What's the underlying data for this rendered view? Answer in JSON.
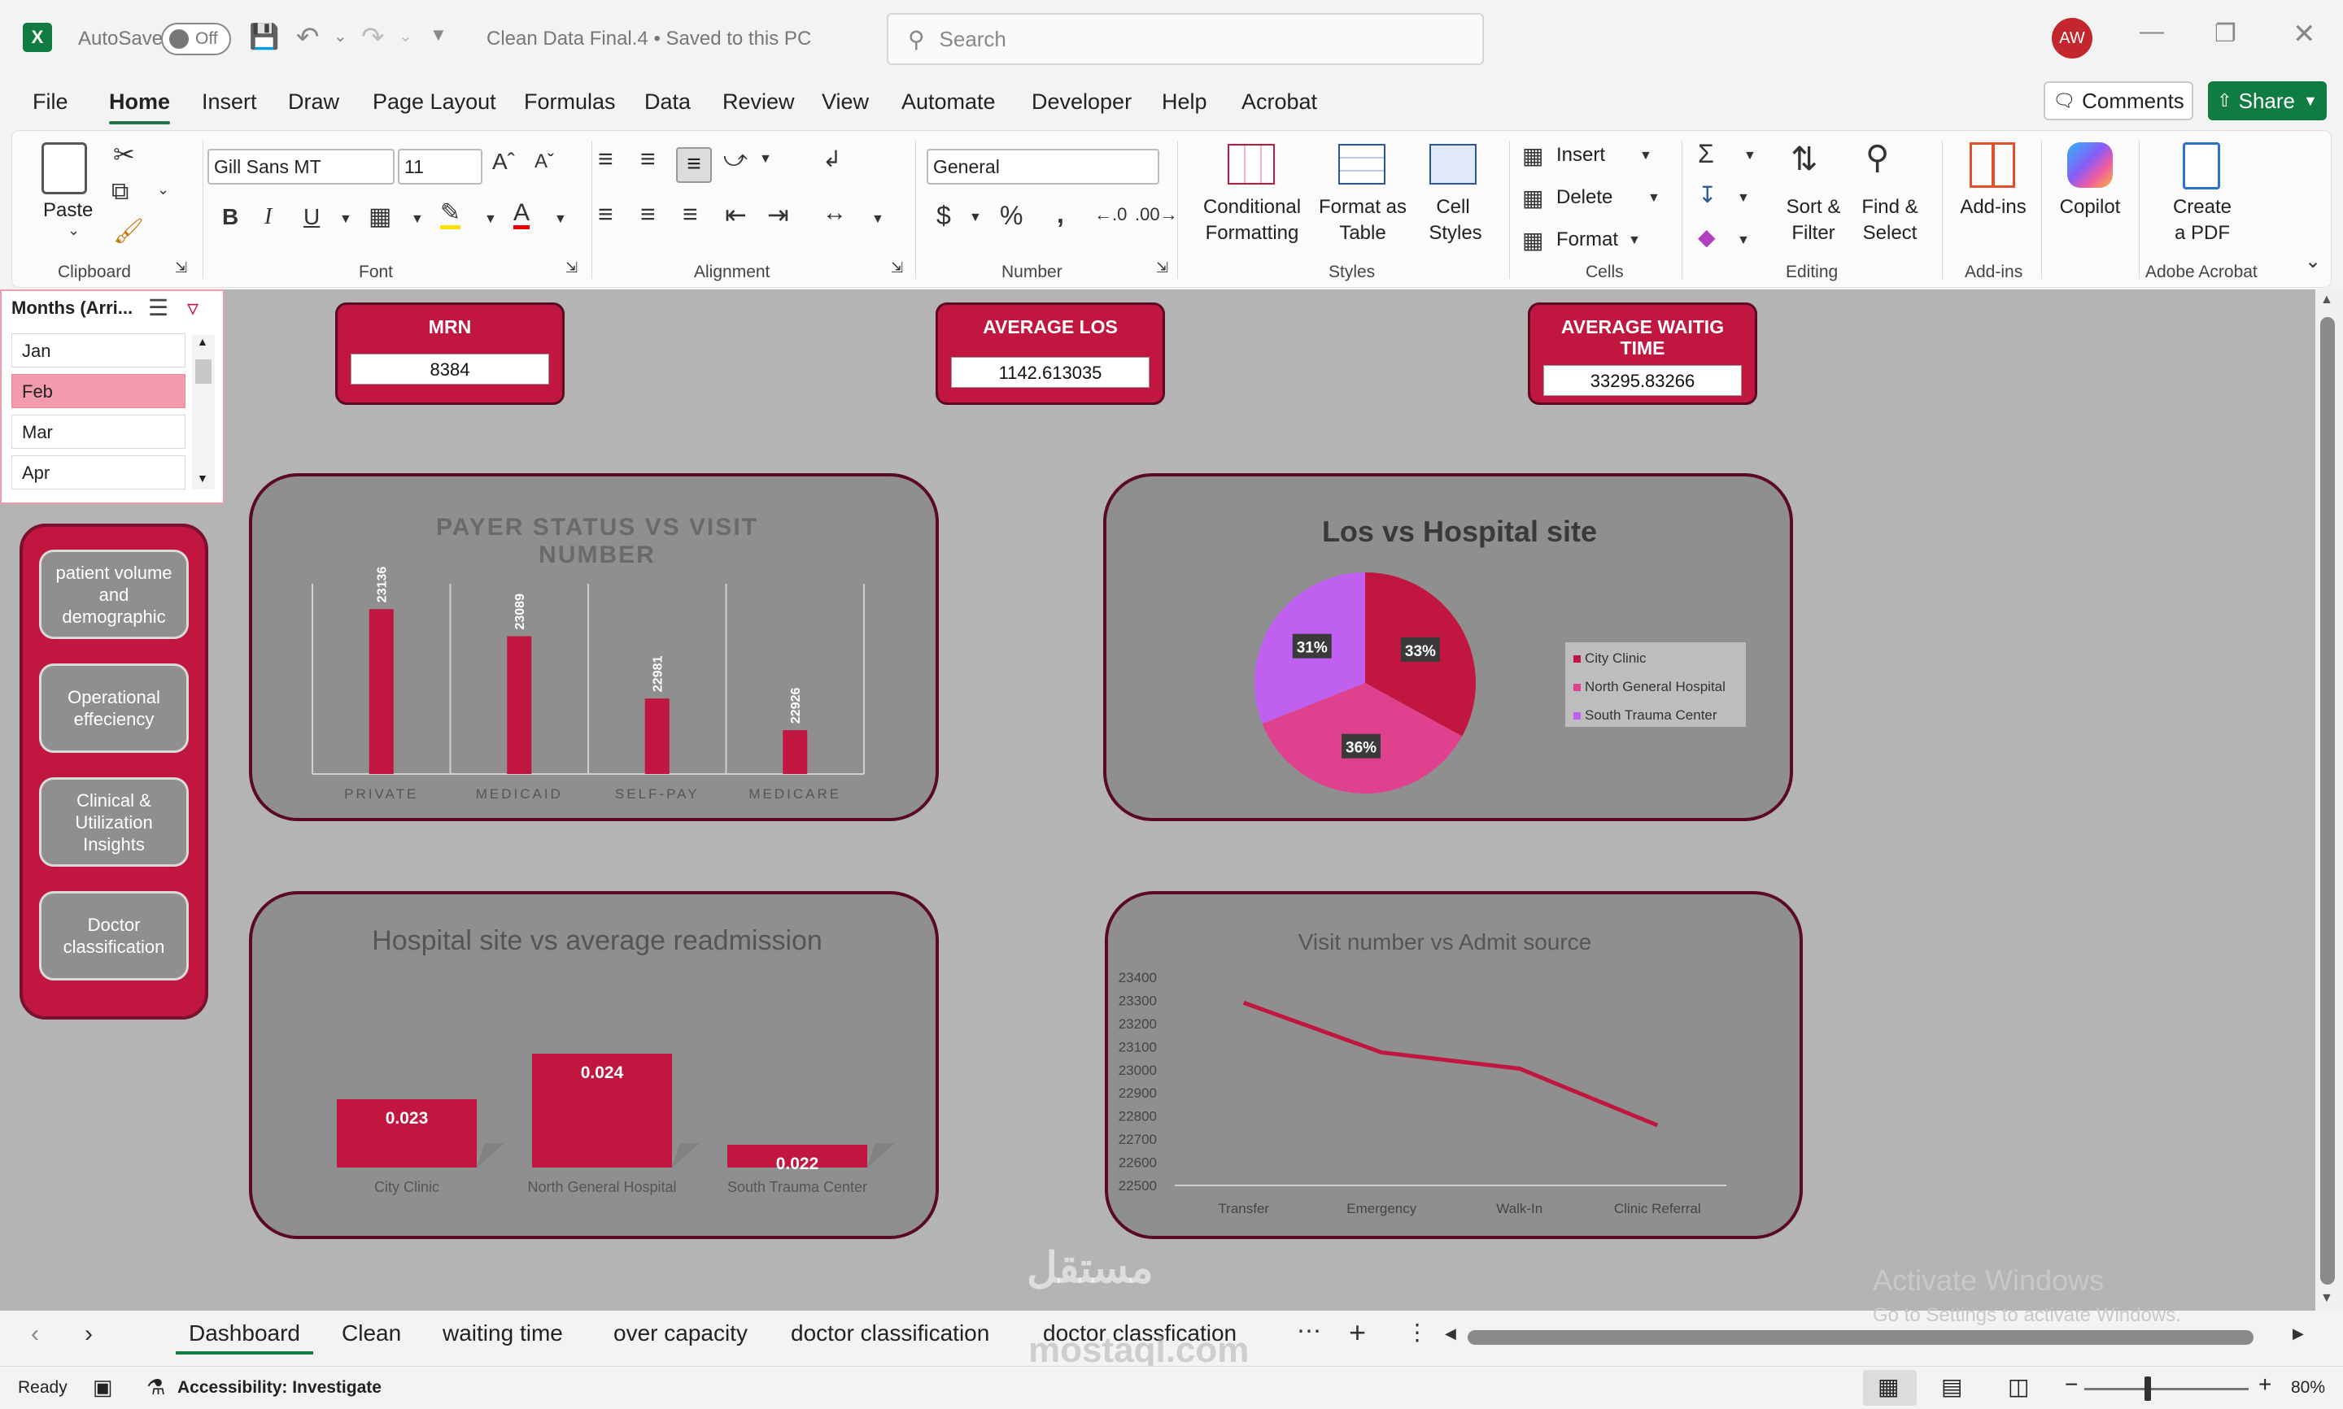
{
  "titlebar": {
    "autosave_label": "AutoSave",
    "autosave_state": "Off",
    "file_title": "Clean Data Final.4  •  Saved to this PC",
    "search_placeholder": "Search",
    "user_initials": "AW"
  },
  "menu": {
    "tabs": [
      "File",
      "Home",
      "Insert",
      "Draw",
      "Page Layout",
      "Formulas",
      "Data",
      "Review",
      "View",
      "Automate",
      "Developer",
      "Help",
      "Acrobat"
    ],
    "active": "Home",
    "comments_label": "Comments",
    "share_label": "Share"
  },
  "ribbon": {
    "clipboard": {
      "paste_label": "Paste",
      "group_label": "Clipboard"
    },
    "font": {
      "font_name": "Gill Sans MT",
      "font_size": "11",
      "group_label": "Font"
    },
    "alignment": {
      "group_label": "Alignment"
    },
    "number": {
      "format": "General",
      "group_label": "Number"
    },
    "styles": {
      "conditional_1": "Conditional",
      "conditional_2": "Formatting",
      "format_table_1": "Format as",
      "format_table_2": "Table",
      "cell_styles_1": "Cell",
      "cell_styles_2": "Styles",
      "group_label": "Styles"
    },
    "cells": {
      "insert": "Insert",
      "delete": "Delete",
      "format": "Format",
      "group_label": "Cells"
    },
    "editing": {
      "sort_1": "Sort &",
      "sort_2": "Filter",
      "find_1": "Find &",
      "find_2": "Select",
      "group_label": "Editing"
    },
    "addins": {
      "label": "Add-ins",
      "group_label": "Add-ins"
    },
    "copilot": {
      "label": "Copilot"
    },
    "acrobat": {
      "label_1": "Create",
      "label_2": "a PDF",
      "group_label": "Adobe Acrobat"
    }
  },
  "slicer": {
    "title": "Months (Arri...",
    "items": [
      "Jan",
      "Feb",
      "Mar",
      "Apr"
    ],
    "selected": "Feb"
  },
  "nav": {
    "buttons": [
      "patient volume and demographic",
      "Operational effeciency",
      "Clinical & Utilization Insights",
      "Doctor classification"
    ]
  },
  "kpis": [
    {
      "label": "MRN",
      "value": "8384"
    },
    {
      "label": "AVERAGE LOS",
      "value": "1142.613035"
    },
    {
      "label": "AVERAGE WAITIG TIME",
      "value": "33295.83266"
    }
  ],
  "colors": {
    "accent": "#c0163f",
    "dark_border": "#5a0a22",
    "panel": "#8f8f8f",
    "pink": "#e0418f",
    "violet": "#c060f0"
  },
  "chart_data": [
    {
      "type": "bar",
      "title": "PAYER STATUS VS VISIT NUMBER",
      "categories": [
        "PRIVATE",
        "MEDICAID",
        "SELF-PAY",
        "MEDICARE"
      ],
      "values": [
        23136,
        23089,
        22981,
        22926
      ],
      "data_labels": [
        "23136",
        "23089",
        "22981",
        "22926"
      ],
      "ylim": [
        22850,
        23180
      ],
      "grid": true
    },
    {
      "type": "pie",
      "title": "Los vs Hospital site",
      "categories": [
        "City Clinic",
        "North General Hospital",
        "South Trauma Center"
      ],
      "values": [
        33,
        36,
        31
      ],
      "data_labels": [
        "33%",
        "36%",
        "31%"
      ],
      "legend": "right"
    },
    {
      "type": "bar",
      "title": "Hospital site vs average readmission",
      "categories": [
        "City Clinic",
        "North General Hospital",
        "South Trauma Center"
      ],
      "values": [
        0.023,
        0.024,
        0.022
      ],
      "data_labels": [
        "0.023",
        "0.024",
        "0.022"
      ],
      "ylim": [
        0.0215,
        0.0245
      ]
    },
    {
      "type": "line",
      "title": "Visit number vs Admit source",
      "categories": [
        "Transfer",
        "Emergency",
        "Walk-In",
        "Clinic Referral"
      ],
      "values": [
        23290,
        23075,
        23005,
        22760
      ],
      "ylim": [
        22500,
        23400
      ],
      "yticks": [
        "23400",
        "23300",
        "23200",
        "23100",
        "23000",
        "22900",
        "22800",
        "22700",
        "22600",
        "22500"
      ]
    }
  ],
  "sheets": {
    "tabs": [
      "Dashboard",
      "Clean",
      "waiting time",
      "over capacity",
      "doctor classification",
      "doctor classfication"
    ],
    "active": "Dashboard"
  },
  "status": {
    "ready": "Ready",
    "accessibility": "Accessibility: Investigate",
    "zoom": "80%",
    "activate_1": "Activate Windows",
    "activate_2": "Go to Settings to activate Windows."
  },
  "watermark": {
    "arabic": "مستقل",
    "latin": "mostaql.com"
  }
}
